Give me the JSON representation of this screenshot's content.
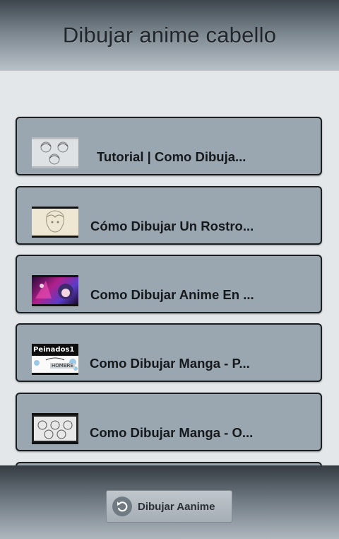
{
  "header": {
    "title": "Dibujar anime cabello"
  },
  "videos": [
    {
      "title": "Tutorial | Como Dibuja..."
    },
    {
      "title": "Cómo Dibujar Un Rostro..."
    },
    {
      "title": "Como Dibujar Anime En ..."
    },
    {
      "title": "Como Dibujar Manga - P..."
    },
    {
      "title": "Como Dibujar Manga - O..."
    }
  ],
  "thumb4": {
    "top_text": "Peinados1",
    "bottom_text": "HOMBRE"
  },
  "footer": {
    "button_label": "Dibujar Aanime",
    "button_icon": "undo-icon"
  },
  "colors": {
    "card": "#9aa7b1",
    "background": "#e3e7ea"
  }
}
